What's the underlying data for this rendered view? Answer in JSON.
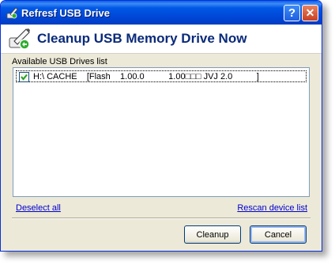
{
  "window": {
    "title": "Refresf USB Drive",
    "help_label": "?",
    "close_label": "✕"
  },
  "header": {
    "title": "Cleanup USB Memory Drive Now"
  },
  "drives": {
    "label": "Available USB Drives list",
    "items": [
      {
        "checked": true,
        "text": "H:\\ CACHE    [Flash    1.00.0          1.00□□□ JVJ 2.0          ]"
      }
    ]
  },
  "links": {
    "deselect_all": "Deselect all",
    "rescan": "Rescan device list"
  },
  "buttons": {
    "cleanup": "Cleanup",
    "cancel": "Cancel"
  },
  "colors": {
    "titlebar": "#0058e6",
    "header_text": "#0a2a7a",
    "link": "#0000cc"
  }
}
